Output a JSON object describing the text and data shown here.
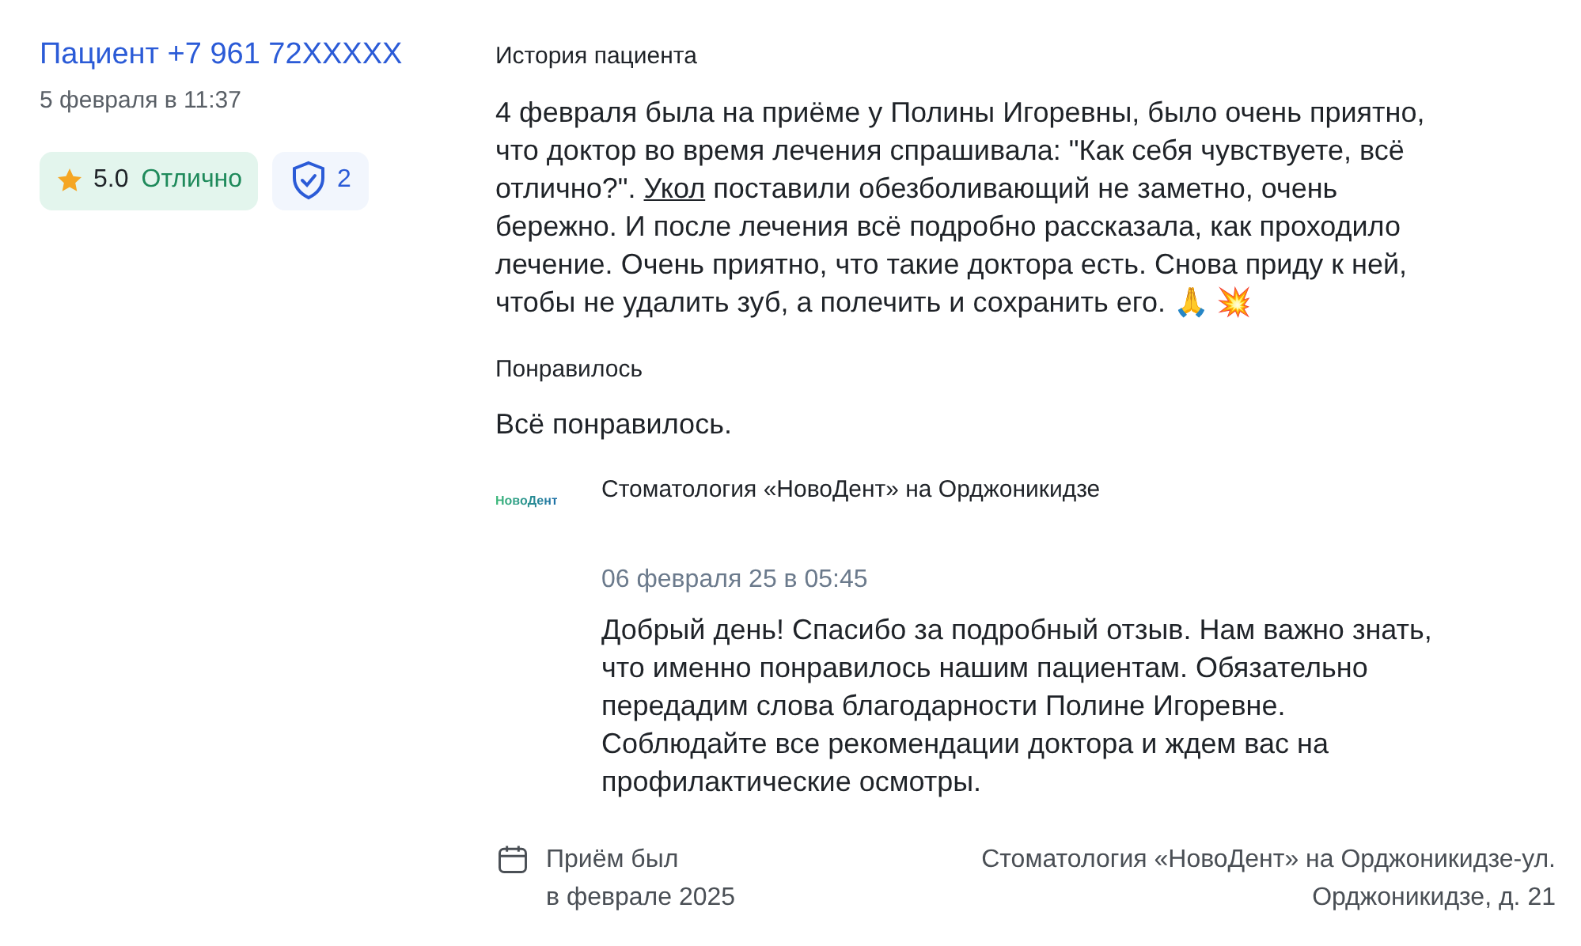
{
  "author": {
    "name": "Пациент +7 961 72XXXXX",
    "date": "5 февраля в 11:37"
  },
  "rating": {
    "score": "5.0",
    "label": "Отлично"
  },
  "verified": {
    "count": "2"
  },
  "story": {
    "heading": "История пациента",
    "before": "4 февраля была на приёме у Полины Игоревны, было очень приятно, что доктор во время лечения спрашивала: \"Как себя чувствуете, всё отлично?\". ",
    "link": "Укол",
    "after": " поставили обезболивающий не заметно, очень бережно. И после лечения всё подробно рассказала, как проходило лечение. Очень приятно, что такие доктора есть. Снова приду к ней, чтобы не удалить зуб, а полечить и сохранить его. 🙏 💥"
  },
  "liked": {
    "heading": "Понравилось",
    "text": "Всё понравилось."
  },
  "reply": {
    "logo_text": "НовоДент",
    "clinic": "Стоматология «НовоДент» на Орджоникидзе",
    "date": "06 февраля 25 в 05:45",
    "text": "Добрый день! Спасибо за подробный отзыв. Нам важно знать, что именно понравилось нашим пациентам. Обязательно передадим слова благодарности Полине Игоревне. Соблюдайте все рекомендации доктора и ждем вас на профилактические осмотры."
  },
  "visit": {
    "line1": "Приём был",
    "line2": "в феврале 2025"
  },
  "address": {
    "line1": "Стоматология «НовоДент» на Орджоникидзе-ул.",
    "line2": "Орджоникидзе, д. 21"
  }
}
